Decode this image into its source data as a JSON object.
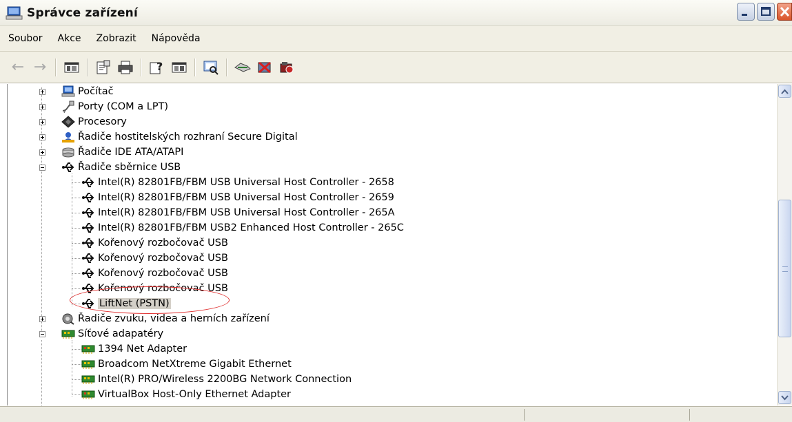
{
  "window": {
    "title": "Správce zařízení"
  },
  "menu": [
    "Soubor",
    "Akce",
    "Zobrazit",
    "Nápověda"
  ],
  "toolbar": {
    "buttons": [
      "back-icon",
      "forward-icon",
      "show-hide-tree-icon",
      "properties-icon",
      "print-icon",
      "help-icon",
      "show-pane-icon",
      "scan-hardware-icon",
      "update-driver-icon",
      "uninstall-icon",
      "disable-icon"
    ]
  },
  "tree": {
    "items": [
      {
        "label": "Počítač",
        "icon": "computer-icon",
        "expander": "plus",
        "level": 0
      },
      {
        "label": "Porty (COM a LPT)",
        "icon": "port-icon",
        "expander": "plus",
        "level": 0
      },
      {
        "label": "Procesory",
        "icon": "cpu-icon",
        "expander": "plus",
        "level": 0
      },
      {
        "label": "Řadiče hostitelských rozhraní Secure Digital",
        "icon": "sd-host-icon",
        "expander": "plus",
        "level": 0
      },
      {
        "label": "Řadiče IDE ATA/ATAPI",
        "icon": "ide-icon",
        "expander": "plus",
        "level": 0
      },
      {
        "label": "Řadiče sběrnice USB",
        "icon": "usb-icon",
        "expander": "minus",
        "level": 0
      },
      {
        "label": "Intel(R) 82801FB/FBM USB Universal Host Controller - 2658",
        "icon": "usb-icon",
        "level": 1
      },
      {
        "label": "Intel(R) 82801FB/FBM USB Universal Host Controller - 2659",
        "icon": "usb-icon",
        "level": 1
      },
      {
        "label": "Intel(R) 82801FB/FBM USB Universal Host Controller - 265A",
        "icon": "usb-icon",
        "level": 1
      },
      {
        "label": "Intel(R) 82801FB/FBM USB2 Enhanced Host Controller - 265C",
        "icon": "usb-icon",
        "level": 1
      },
      {
        "label": "Kořenový rozbočovač USB",
        "icon": "usb-icon",
        "level": 1
      },
      {
        "label": "Kořenový rozbočovač USB",
        "icon": "usb-icon",
        "level": 1
      },
      {
        "label": "Kořenový rozbočovač USB",
        "icon": "usb-icon",
        "level": 1
      },
      {
        "label": "Kořenový rozbočovač USB",
        "icon": "usb-icon",
        "level": 1
      },
      {
        "label": "LiftNet (PSTN)",
        "icon": "usb-icon",
        "level": 1,
        "selected": true
      },
      {
        "label": "Řadiče zvuku, videa a herních zařízení",
        "icon": "sound-icon",
        "expander": "plus",
        "level": 0
      },
      {
        "label": "Síťové adapatéry",
        "icon": "network-adapter-icon",
        "expander": "minus",
        "level": 0
      },
      {
        "label": "1394 Net Adapter",
        "icon": "network-adapter-icon",
        "level": 1
      },
      {
        "label": "Broadcom NetXtreme Gigabit Ethernet",
        "icon": "network-adapter-icon",
        "level": 1
      },
      {
        "label": "Intel(R) PRO/Wireless 2200BG Network Connection",
        "icon": "network-adapter-icon",
        "level": 1
      },
      {
        "label": "VirtualBox Host-Only Ethernet Adapter",
        "icon": "network-adapter-icon",
        "level": 1
      }
    ]
  },
  "colors": {
    "annotation": "#e03030",
    "usb_icon": "#222222",
    "net_adapter": "#2f8a2f"
  }
}
